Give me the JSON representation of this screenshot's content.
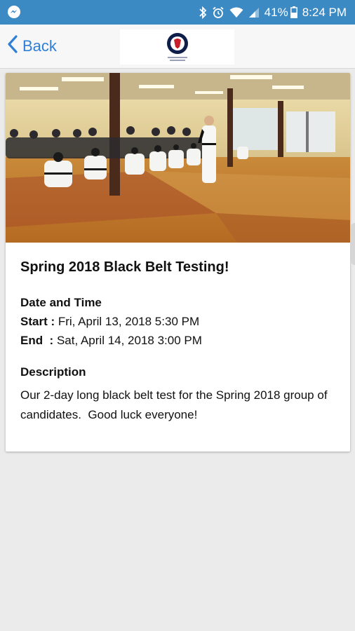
{
  "status_bar": {
    "battery": "41%",
    "time": "8:24 PM",
    "icons": [
      "messenger-icon",
      "bluetooth-icon",
      "alarm-icon",
      "wifi-icon",
      "signal-icon",
      "battery-icon"
    ]
  },
  "nav": {
    "back_label": "Back",
    "logo": "school-logo"
  },
  "event": {
    "title": "Spring 2018 Black Belt Testing!",
    "datetime_heading": "Date and Time",
    "start_label": "Start :",
    "start_value": " Fri, April 13, 2018 5:30 PM",
    "end_label": "End  :",
    "end_value": " Sat, April 14, 2018 3:00 PM",
    "description_heading": "Description",
    "description": "Our 2-day long black belt test for the Spring 2018 group of candidates.  Good luck everyone!"
  },
  "colors": {
    "status_bar": "#3c8ac4",
    "accent": "#2f7fd6",
    "background": "#ebebec"
  }
}
